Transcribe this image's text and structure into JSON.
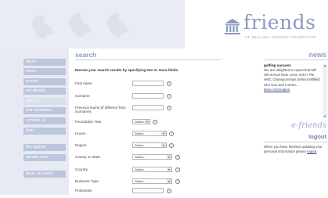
{
  "brand": {
    "logo_word": "friends",
    "tagline": "OF MILL HILL SCHOOL FOUNDATION",
    "logo_icon": "building-columns-icon"
  },
  "sidebar": {
    "items": [
      {
        "label": "home",
        "active": false
      },
      {
        "label": "news",
        "active": false
      },
      {
        "label": "events",
        "active": false
      },
      {
        "label": "my details",
        "active": false
      },
      {
        "label": "search",
        "active": true
      },
      {
        "label": "lost members",
        "active": false
      },
      {
        "label": "contact us",
        "active": false
      },
      {
        "label": "links",
        "active": false
      },
      {
        "label": "the appeal",
        "active": false
      },
      {
        "label": "donate now",
        "active": false
      },
      {
        "label": "book an event",
        "active": false
      }
    ]
  },
  "main": {
    "title": "search",
    "intro": "Narrow your search results by specifying two or more fields.",
    "fields": [
      {
        "label": "First name",
        "type": "text",
        "value": ""
      },
      {
        "label": "Surname",
        "type": "text",
        "value": ""
      },
      {
        "label": "Previous Name (if different from Surname)",
        "type": "text",
        "value": ""
      },
      {
        "label": "Foundation Year",
        "type": "select-short",
        "value": "Select..."
      },
      {
        "label": "House",
        "type": "select-mid",
        "value": "Select..."
      },
      {
        "label": "Region",
        "type": "select-mid",
        "value": "Select..."
      },
      {
        "label": "County or State",
        "type": "select",
        "value": "Select..."
      },
      {
        "label": "Country",
        "type": "select",
        "value": "Select..."
      },
      {
        "label": "Business Type",
        "type": "select",
        "value": "Select..."
      },
      {
        "label": "Profession",
        "type": "text",
        "value": ""
      }
    ]
  },
  "news": {
    "title": "news",
    "head": "golfing success",
    "body": "We are delighted to report that Mill Hill School have come 3rd in The HMC Championships behind Millfield who won and Loretto...",
    "more": "More Information"
  },
  "efriends": {
    "title": "e-friends",
    "logout": "logout",
    "text": "When you have finished updating your personal information please",
    "link": "logout"
  }
}
